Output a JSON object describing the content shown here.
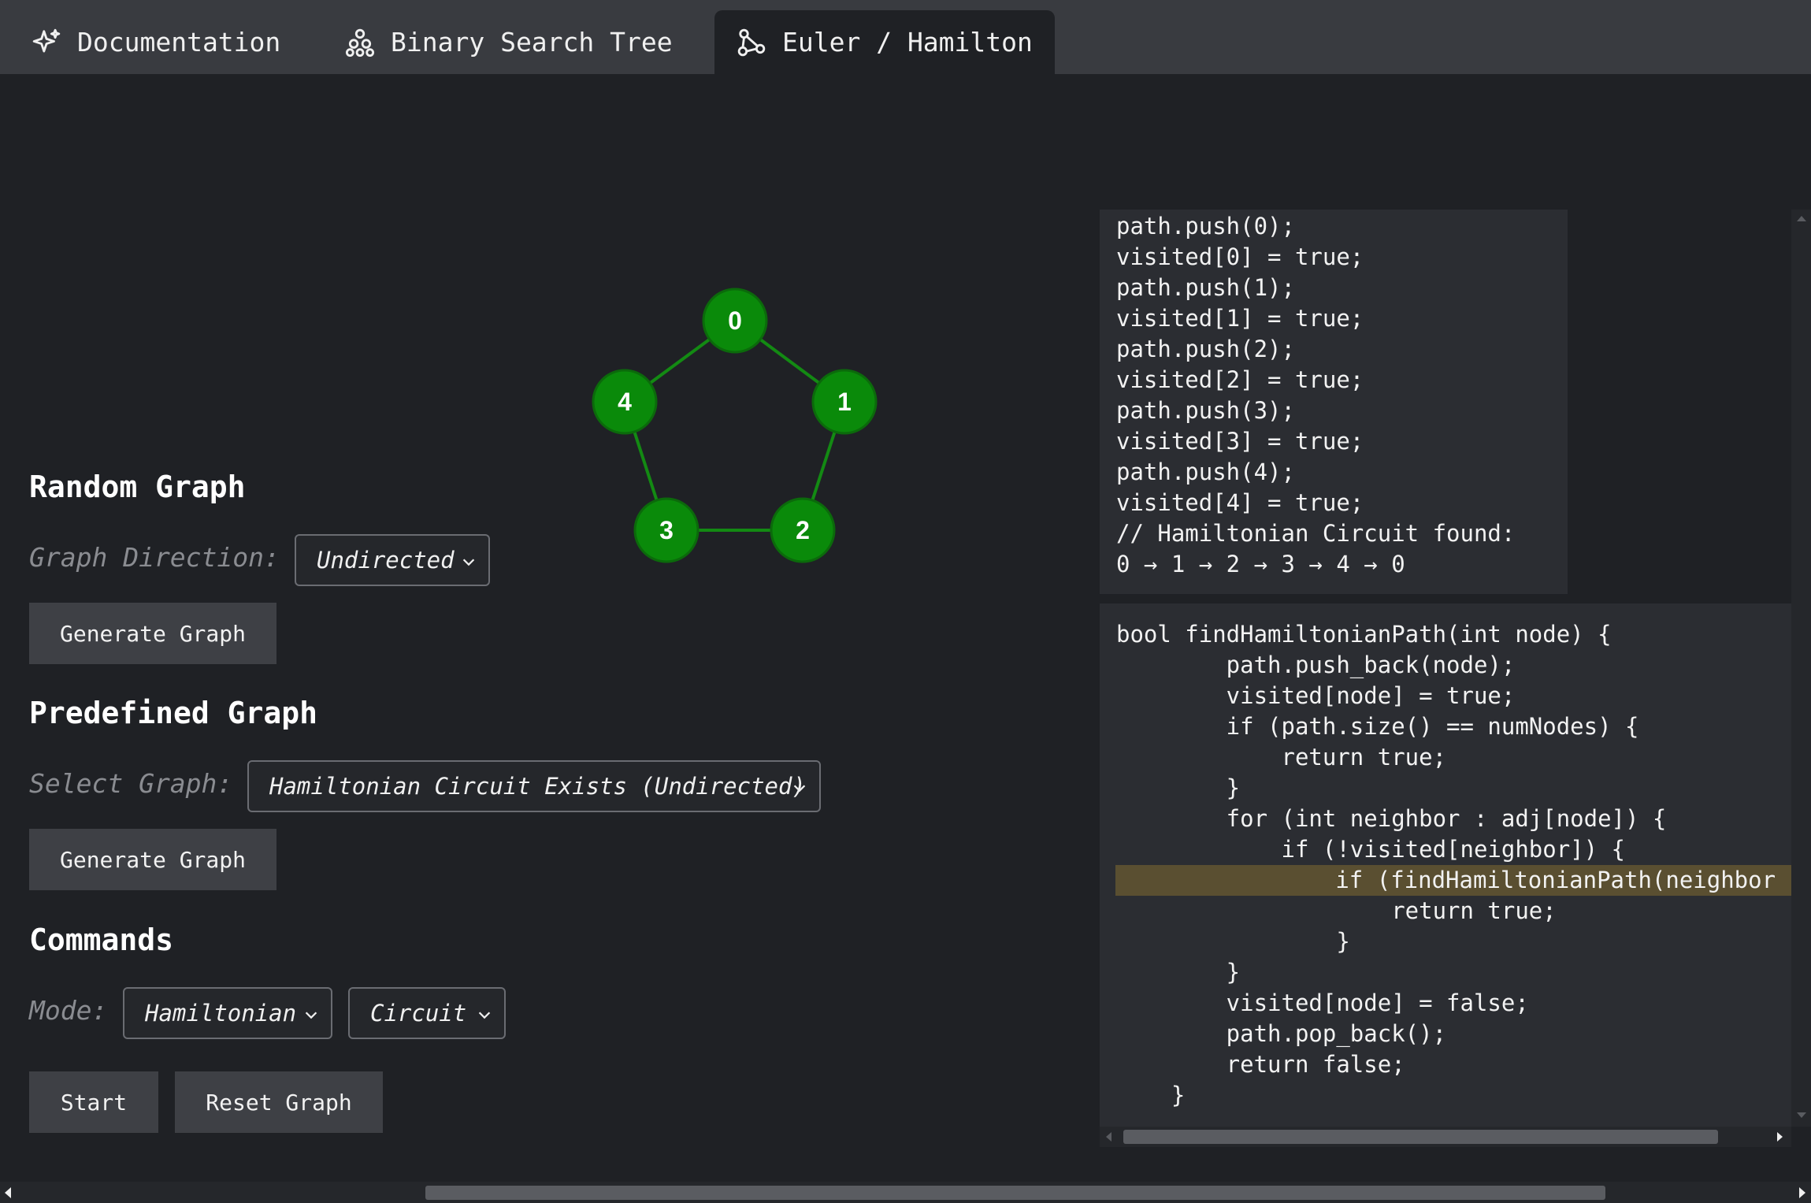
{
  "tabs": [
    {
      "label": "Documentation",
      "icon": "sparkle-icon"
    },
    {
      "label": "Binary Search Tree",
      "icon": "tree-icon"
    },
    {
      "label": "Euler / Hamilton",
      "icon": "graph-icon",
      "active": true
    }
  ],
  "random_graph": {
    "heading": "Random Graph",
    "direction_label": "Graph Direction:",
    "direction_value": "Undirected",
    "generate_label": "Generate Graph"
  },
  "predefined_graph": {
    "heading": "Predefined Graph",
    "select_label": "Select Graph:",
    "select_value": "Hamiltonian Circuit Exists (Undirected)",
    "generate_label": "Generate Graph"
  },
  "commands": {
    "heading": "Commands",
    "mode_label": "Mode:",
    "mode_value": "Hamiltonian",
    "type_value": "Circuit",
    "start_label": "Start",
    "reset_label": "Reset Graph"
  },
  "graph": {
    "node_color": "#0a8a0a",
    "edge_color": "#138a13",
    "nodes": [
      "0",
      "1",
      "2",
      "3",
      "4"
    ],
    "edges": [
      [
        "0",
        "1"
      ],
      [
        "1",
        "2"
      ],
      [
        "2",
        "3"
      ],
      [
        "3",
        "4"
      ],
      [
        "4",
        "0"
      ]
    ]
  },
  "log_lines": [
    "path.push(0);",
    "visited[0] = true;",
    "path.push(1);",
    "visited[1] = true;",
    "path.push(2);",
    "visited[2] = true;",
    "path.push(3);",
    "visited[3] = true;",
    "path.push(4);",
    "visited[4] = true;",
    "// Hamiltonian Circuit found:",
    "0 → 1 → 2 → 3 → 4 → 0"
  ],
  "code_lines": [
    "bool findHamiltonianPath(int node) {",
    "        path.push_back(node);",
    "        visited[node] = true;",
    "        if (path.size() == numNodes) {",
    "            return true;",
    "        }",
    "        for (int neighbor : adj[node]) {",
    "            if (!visited[neighbor]) {",
    "                if (findHamiltonianPath(neighbor",
    "                    return true;",
    "                }",
    "        }",
    "        visited[node] = false;",
    "        path.pop_back();",
    "        return false;",
    "    }"
  ],
  "highlight_line_index": 8
}
